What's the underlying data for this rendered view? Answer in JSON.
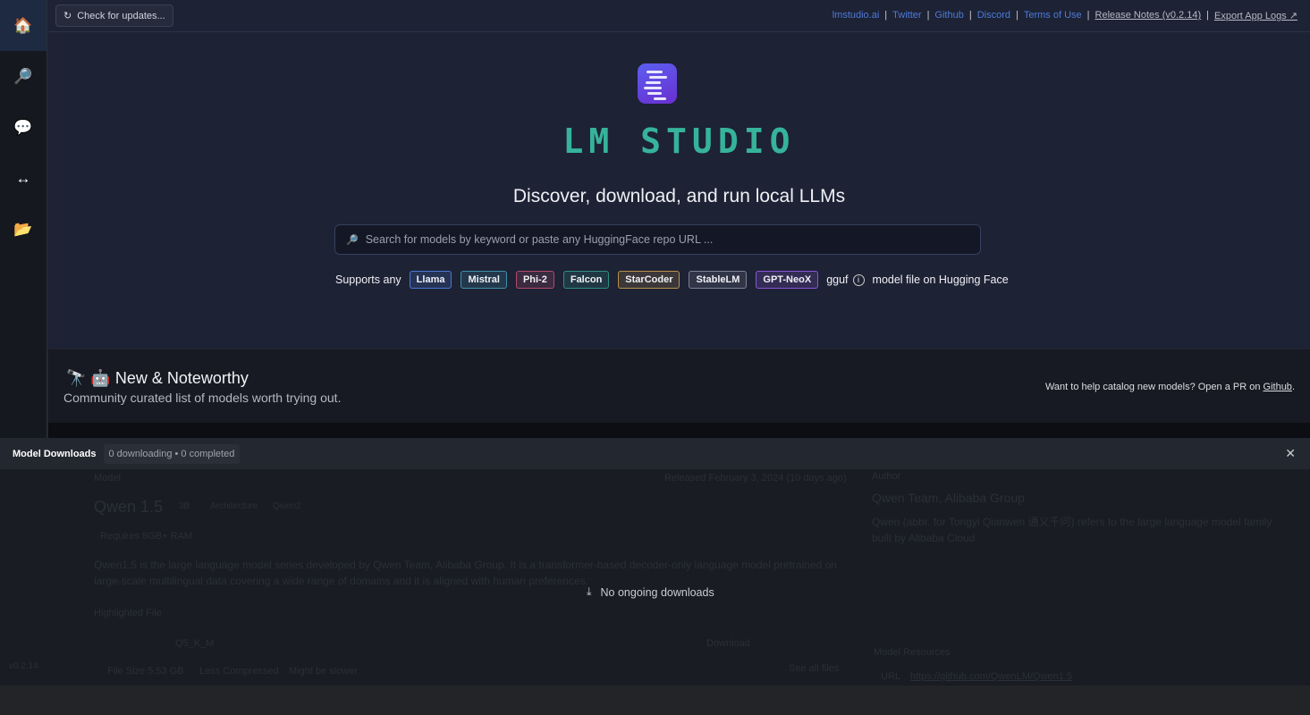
{
  "sidebar": {
    "items": [
      {
        "name": "home",
        "icon": "🏠"
      },
      {
        "name": "search",
        "icon": "🔎"
      },
      {
        "name": "chat",
        "icon": "💬"
      },
      {
        "name": "server",
        "icon": "↔"
      },
      {
        "name": "models",
        "icon": "📂"
      }
    ],
    "version": "v0.2.14"
  },
  "topbar": {
    "check_updates": "Check for updates...",
    "links": [
      "lmstudio.ai",
      "Twitter",
      "Github",
      "Discord",
      "Terms of Use"
    ],
    "release_notes": "Release Notes (v0.2.14)",
    "export_logs": "Export App Logs ↗",
    "separator": "|"
  },
  "hero": {
    "logo_text": "LM STUDIO",
    "tagline": "Discover, download, and run local LLMs",
    "search_placeholder": "Search for models by keyword or paste any HuggingFace repo URL ...",
    "supports_prefix": "Supports any",
    "supports_suffix": "model file on Hugging Face",
    "gguf": "gguf",
    "tags": [
      {
        "label": "Llama",
        "color": "#4a78d8"
      },
      {
        "label": "Mistral",
        "color": "#3f8fa8"
      },
      {
        "label": "Phi-2",
        "color": "#b34a6c"
      },
      {
        "label": "Falcon",
        "color": "#2f8f80"
      },
      {
        "label": "StarCoder",
        "color": "#b8914a"
      },
      {
        "label": "StableLM",
        "color": "#7d8494"
      },
      {
        "label": "GPT-NeoX",
        "color": "#8a55d8"
      }
    ]
  },
  "noteworthy": {
    "icons": "🔭 🤖",
    "title": "New & Noteworthy",
    "subtitle": "Community curated list of models worth trying out.",
    "help_text": "Want to help catalog new models? Open a PR on ",
    "help_link": "Github",
    "help_end": "."
  },
  "downloads": {
    "title": "Model Downloads",
    "count": "0 downloading • 0 completed",
    "empty": "No ongoing downloads"
  },
  "background_card": {
    "model_label": "Model",
    "model_name": "Qwen 1.5",
    "size": "3B",
    "arch_label": "Architecture",
    "arch": "Qwen2",
    "requires": "Requires  8GB+ RAM",
    "released": "Released  February 3, 2024 (10 days ago)",
    "description": "Qwen1.5 is the large language model series developed by Qwen Team, Alibaba Group. It is a transformer-based decoder-only language model pretrained on large-scale multilingual data covering a wide range of domains and it is aligned with human preferences.",
    "highlighted": "Highlighted File",
    "quant": "Q5_K_M",
    "download": "Download",
    "file_size": "File Size  5.53 GB",
    "less_compressed": "Less Compressed",
    "slower": "Might be slower",
    "see_all": "See all files",
    "author_label": "Author",
    "author": "Qwen Team, Alibaba Group",
    "author_desc": "Qwen (abbr. for Tongyi Qianwen 通义千问) refers to the large language model family built by Alibaba Cloud",
    "resources": "Model Resources",
    "url_label": "URL",
    "url": "https://github.com/QwenLM/Qwen1.5"
  }
}
